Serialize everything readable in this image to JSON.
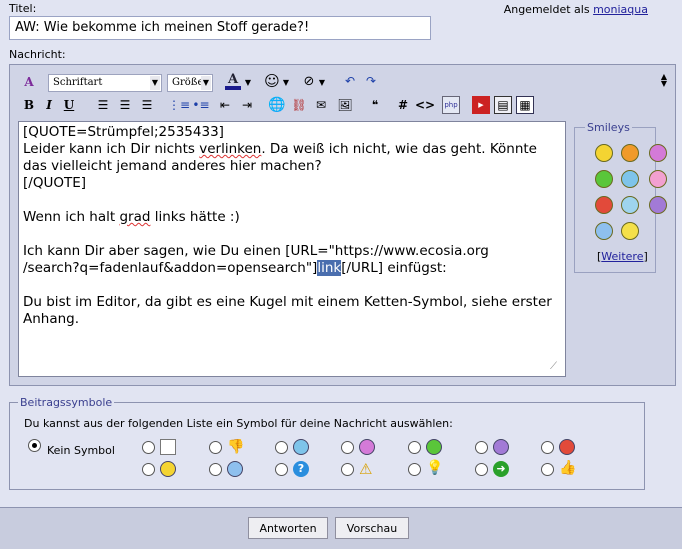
{
  "form": {
    "title_label": "Titel:",
    "title_value": "AW: Wie bekomme ich meinen Stoff gerade?!",
    "logged_in_prefix": "Angemeldet als",
    "username": "moniaqua",
    "message_label": "Nachricht:"
  },
  "toolbar": {
    "font_select": "Schriftart",
    "size_select": "Größe",
    "bold": "B",
    "italic": "I",
    "underline": "U",
    "code_hash": "#",
    "code_tag": "<>"
  },
  "message_text": {
    "l1": "[QUOTE=Strümpfel;2535433]",
    "l2a": "Leider kann ich Dir nichts ",
    "l2b": "verlinken",
    "l2c": ". Da weiß ich nicht, wie das geht. Könnte",
    "l3": "das vielleicht jemand anderes hier machen?",
    "l4": "[/QUOTE]",
    "l6a": "Wenn ich halt ",
    "l6b": "grad",
    "l6c": " links hätte :)",
    "l8": "Ich kann Dir aber sagen, wie Du einen [URL=\"https://www.ecosia.org",
    "l9a": "/search?q=fadenlauf&addon=opensearch\"]",
    "l9b": "link",
    "l9c": "[/URL] einfügst:",
    "l11": "Du bist im Editor, da gibt es eine Kugel mit einem Ketten-Symbol, siehe erster",
    "l12": "Anhang."
  },
  "smileys": {
    "legend": "Smileys",
    "more_link": "Weitere",
    "more_open": "[",
    "more_close": "]",
    "items": [
      "smile-icon",
      "confused-icon",
      "big-grin-icon",
      "grin-icon",
      "wink-icon",
      "tongue-icon",
      "mad-icon",
      "frown-icon",
      "eek-icon",
      "rolleyes-icon",
      "cool-icon"
    ]
  },
  "post_icons": {
    "legend": "Beitragssymbole",
    "instruction": "Du kannst aus der folgenden Liste ein Symbol für deine Nachricht auswählen:",
    "no_symbol": "Kein Symbol",
    "selected": "Kein Symbol"
  },
  "buttons": {
    "submit": "Antworten",
    "preview": "Vorschau"
  },
  "colors": {
    "page_bg": "#e1e4f2",
    "editor_bg": "#d0d4e6",
    "link": "#22229c",
    "legend": "#3a3f8f",
    "selection": "#4a6eae"
  }
}
